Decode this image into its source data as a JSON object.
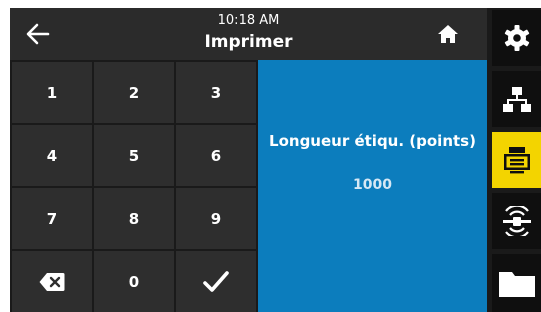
{
  "header": {
    "time": "10:18 AM",
    "title": "Imprimer",
    "back_icon": "arrow-left-icon",
    "home_icon": "home-icon"
  },
  "keypad": {
    "keys": [
      "1",
      "2",
      "3",
      "4",
      "5",
      "6",
      "7",
      "8",
      "9",
      "",
      "0",
      ""
    ],
    "backspace_icon": "backspace-icon",
    "confirm_icon": "checkmark-icon"
  },
  "panel": {
    "label": "Longueur étiqu. (points)",
    "value": "1000"
  },
  "sidebar": {
    "items": [
      {
        "icon": "gear-icon",
        "active": false
      },
      {
        "icon": "network-icon",
        "active": false
      },
      {
        "icon": "printer-icon",
        "active": true
      },
      {
        "icon": "rfid-icon",
        "active": false
      },
      {
        "icon": "folder-icon",
        "active": false
      }
    ]
  },
  "colors": {
    "accent_blue": "#0c7dbd",
    "active_yellow": "#f3d400",
    "key_bg": "#2e2e2e",
    "header_bg": "#2b2b2b"
  }
}
